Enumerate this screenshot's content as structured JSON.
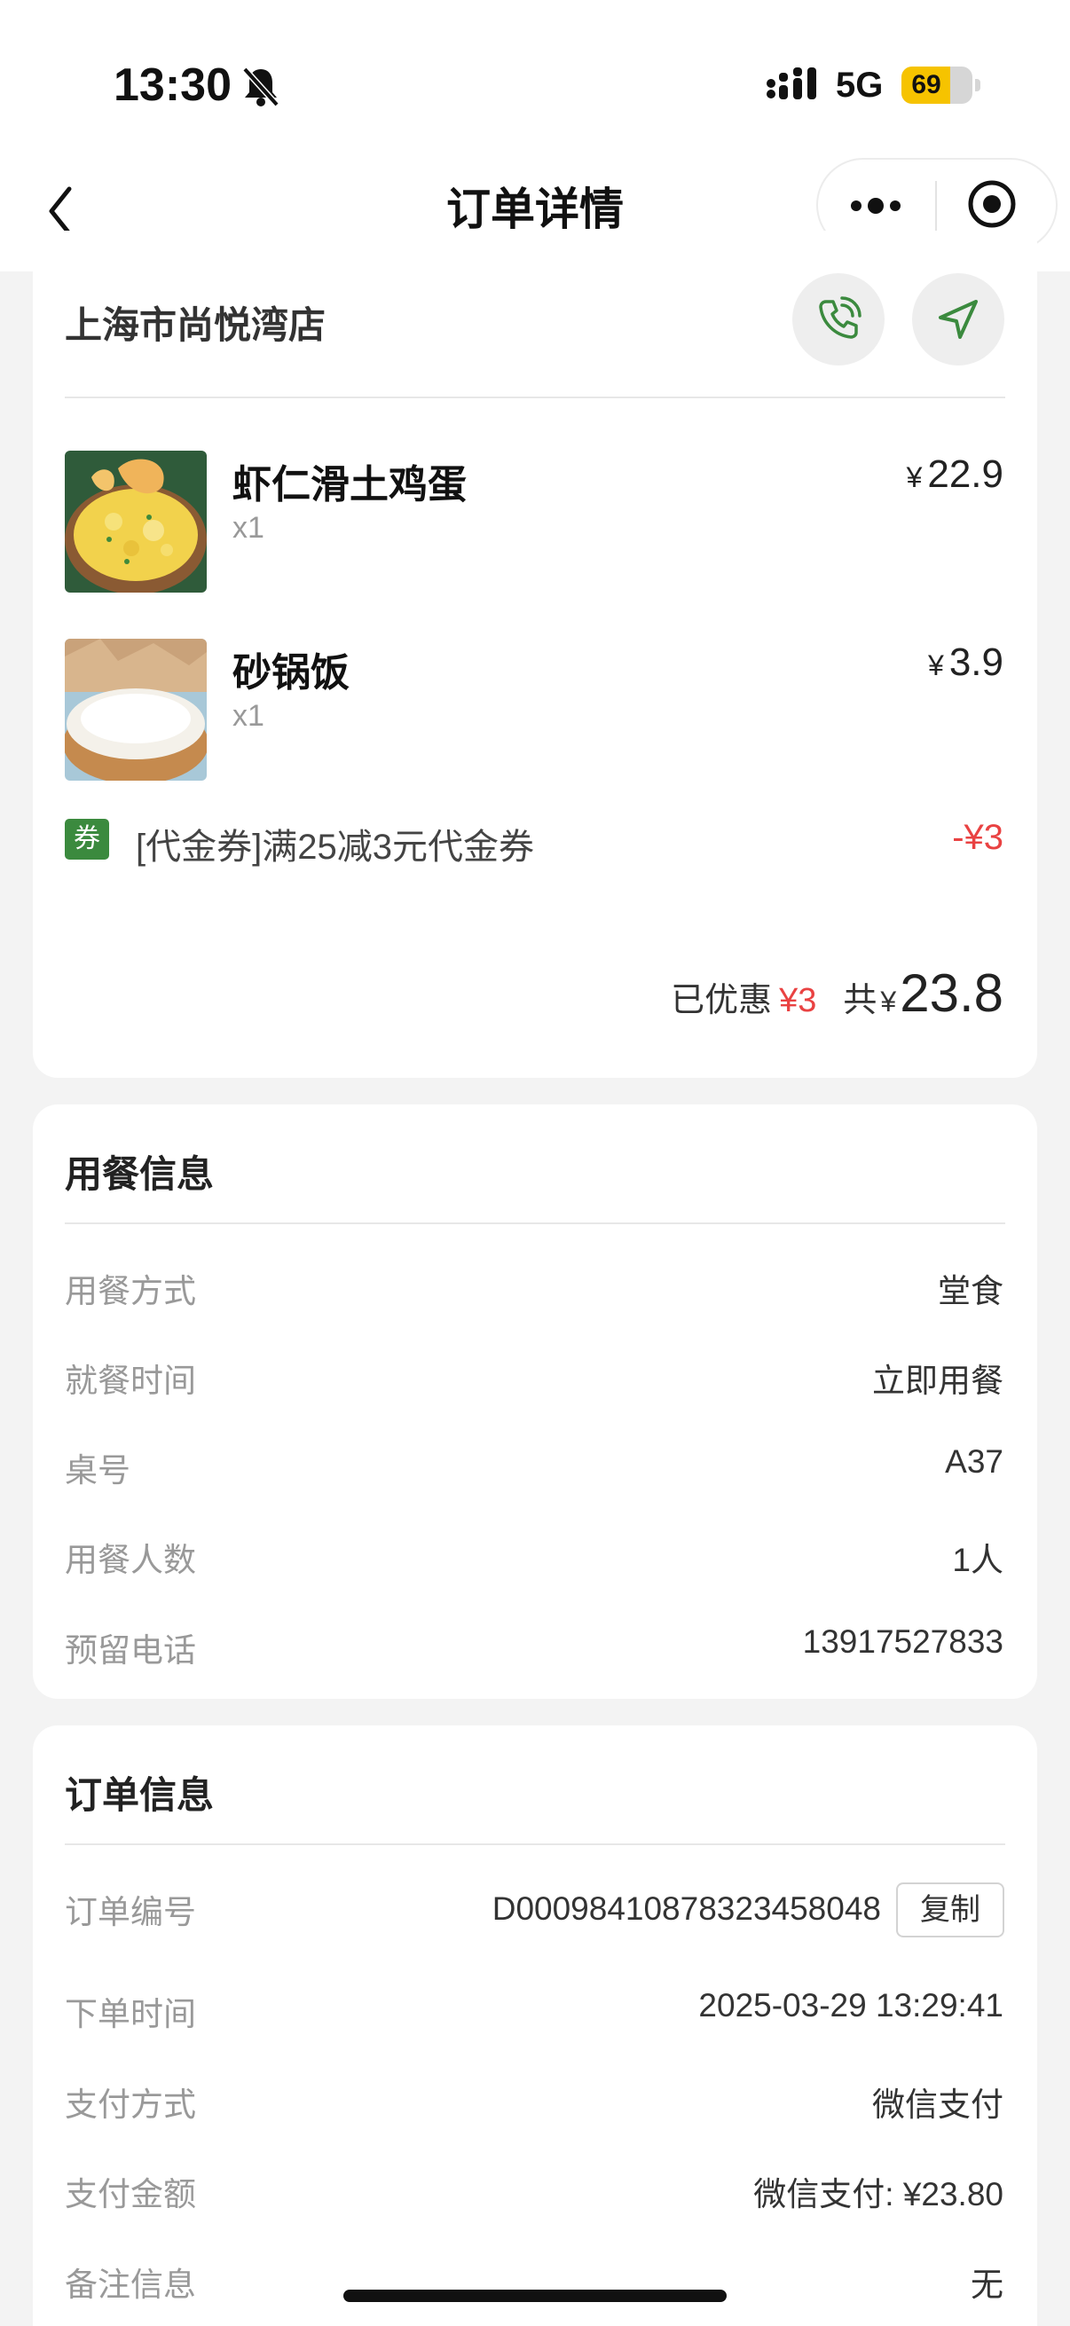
{
  "status_bar": {
    "time": "13:30",
    "network": "5G",
    "battery_percent": "69",
    "battery_level": 0.69,
    "icons": [
      "bell-slash-icon",
      "signal-icon"
    ]
  },
  "nav": {
    "title": "订单详情",
    "icons": [
      "back-icon",
      "more-icon",
      "target-icon"
    ]
  },
  "order": {
    "store_name": "上海市尚悦湾店",
    "icons": [
      "phone-icon",
      "navigation-icon"
    ],
    "items": [
      {
        "name": "虾仁滑土鸡蛋",
        "qty": "x1",
        "currency": "¥",
        "price": "22.9"
      },
      {
        "name": "砂锅饭",
        "qty": "x1",
        "currency": "¥",
        "price": "3.9"
      }
    ],
    "coupon": {
      "badge": "券",
      "text": "[代金券]满25减3元代金券",
      "amount": "-¥3"
    },
    "summary": {
      "discount_label": "已优惠",
      "discount_value": "¥3",
      "total_label": "共",
      "currency": "¥",
      "total": "23.8"
    }
  },
  "dining": {
    "title": "用餐信息",
    "rows": [
      {
        "label": "用餐方式",
        "value": "堂食"
      },
      {
        "label": "就餐时间",
        "value": "立即用餐"
      },
      {
        "label": "桌号",
        "value": "A37"
      },
      {
        "label": "用餐人数",
        "value": "1人"
      },
      {
        "label": "预留电话",
        "value": "13917527833"
      }
    ]
  },
  "order_info": {
    "title": "订单信息",
    "copy_label": "复制",
    "rows": [
      {
        "label": "订单编号",
        "value": "D000984108783234580​48"
      },
      {
        "label": "下单时间",
        "value": "2025-03-29 13:29:41"
      },
      {
        "label": "支付方式",
        "value": "微信支付"
      },
      {
        "label": "支付金额",
        "value": "微信支付: ¥23.80"
      },
      {
        "label": "备注信息",
        "value": "无"
      }
    ]
  },
  "colors": {
    "accent_green": "#3b8a3e",
    "discount_red": "#e94242",
    "battery_yellow": "#f6c300",
    "background": "#f3f3f3"
  }
}
